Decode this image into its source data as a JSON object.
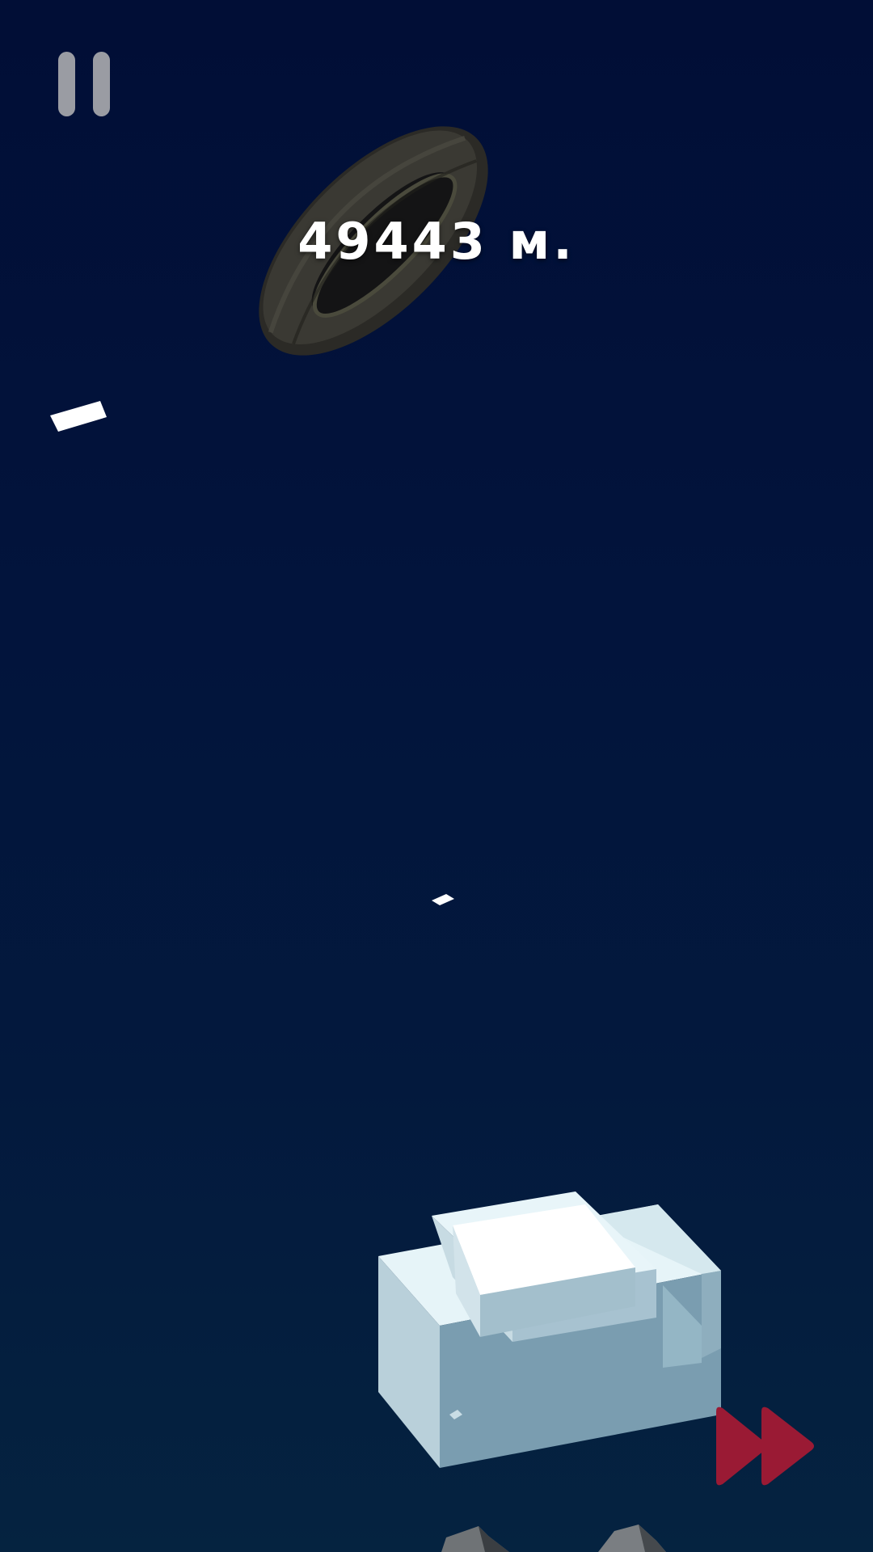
{
  "hud": {
    "distance_label": "49443 м.",
    "pause_icon": "pause-icon",
    "skip_icon": "fast-forward-icon"
  },
  "scene": {
    "objects": [
      "tire",
      "ice-block",
      "snow-flake",
      "rock"
    ]
  },
  "colors": {
    "background_top": "#010e36",
    "background_bottom": "#052340",
    "pause_gray": "#9a9ca3",
    "skip_red": "#9a1a34",
    "ice_light": "#e6f4f8",
    "ice_mid": "#a7c2d0",
    "ice_dark": "#7a9db0",
    "tire_dark": "#2b2a26"
  }
}
